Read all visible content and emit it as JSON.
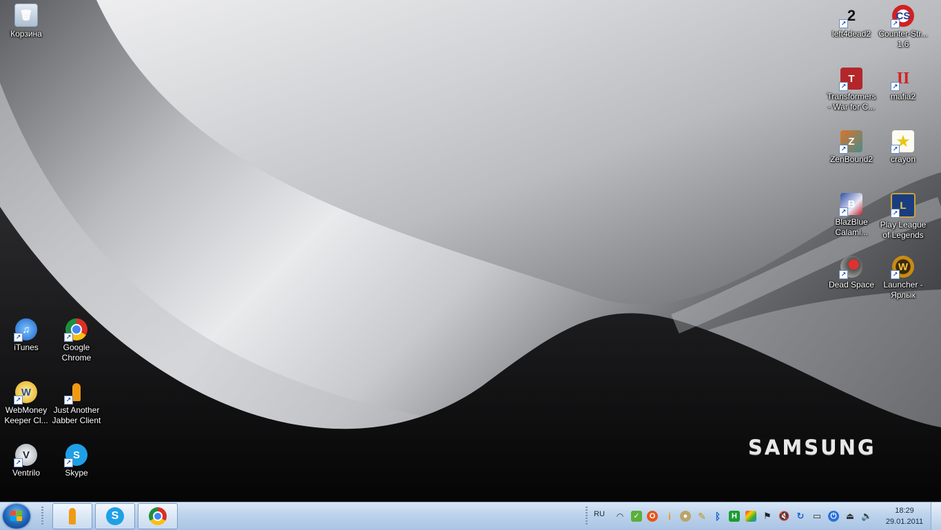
{
  "desktop_left": [
    {
      "name": "recycle-bin",
      "label": "Корзина",
      "icon": "recycle-bin-icon",
      "color": "#c9d6e4"
    },
    {
      "name": "itunes",
      "label": "iTunes",
      "icon": "itunes-icon",
      "color": "#2a7de1"
    },
    {
      "name": "google-chrome",
      "label": "Google Chrome",
      "icon": "chrome-icon",
      "color": "#e8b21c"
    },
    {
      "name": "webmoney",
      "label": "WebMoney Keeper Cl...",
      "icon": "webmoney-icon",
      "color": "#f2c220"
    },
    {
      "name": "jabber",
      "label": "Just Another Jabber Client",
      "icon": "jabber-icon",
      "color": "#f09a13"
    },
    {
      "name": "ventrilo",
      "label": "Ventrilo",
      "icon": "ventrilo-icon",
      "color": "#d8d8d8"
    },
    {
      "name": "skype",
      "label": "Skype",
      "icon": "skype-icon",
      "color": "#1ea0e6"
    }
  ],
  "desktop_right": [
    {
      "name": "left4dead2",
      "label": "left4dead2",
      "icon": "left4dead2-icon",
      "color": "#ffffff"
    },
    {
      "name": "counter-strike",
      "label": "Counter-Str... 1.6",
      "icon": "counter-strike-icon",
      "color": "#d02121"
    },
    {
      "name": "transformers",
      "label": "Transformers - War for C...",
      "icon": "transformers-icon",
      "color": "#b3262a"
    },
    {
      "name": "mafia2",
      "label": "mafia2",
      "icon": "mafia2-icon",
      "color": "#d61f26"
    },
    {
      "name": "zenbound2",
      "label": "ZenBound2",
      "icon": "zenbound2-icon",
      "color": "#b5501e"
    },
    {
      "name": "crayon",
      "label": "crayon",
      "icon": "crayon-icon",
      "color": "#f2e84a"
    },
    {
      "name": "blazblue",
      "label": "BlazBlue Calami...",
      "icon": "blazblue-icon",
      "color": "#2f4fa8"
    },
    {
      "name": "league-of-legends",
      "label": "Play League of Legends",
      "icon": "league-icon",
      "color": "#1a3d80"
    },
    {
      "name": "dead-space",
      "label": "Dead Space",
      "icon": "dead-space-icon",
      "color": "#8a1c1c"
    },
    {
      "name": "launcher",
      "label": "Launcher - Ярлык",
      "icon": "wow-launcher-icon",
      "color": "#c98b12"
    }
  ],
  "wallpaper": {
    "brand": "SAMSUNG"
  },
  "taskbar": {
    "start": "start-icon",
    "pinned": [
      {
        "name": "jabber-task",
        "icon": "jabber-icon",
        "color": "#f09a13"
      },
      {
        "name": "skype-task",
        "icon": "skype-icon",
        "color": "#1ea0e6"
      },
      {
        "name": "chrome-task",
        "icon": "chrome-icon",
        "color": "#e8b21c"
      }
    ],
    "language": "RU",
    "tray_icons": [
      "wifi-icon",
      "shield-icon",
      "opera-icon",
      "info-icon",
      "media-icon",
      "pen-icon",
      "bluetooth-icon",
      "network-icon",
      "color-icon",
      "flag-icon",
      "speaker-mute-icon",
      "update-icon",
      "monitor-icon",
      "power-icon",
      "eject-icon",
      "volume-icon"
    ],
    "time": "18:29",
    "date": "29.01.2011"
  }
}
